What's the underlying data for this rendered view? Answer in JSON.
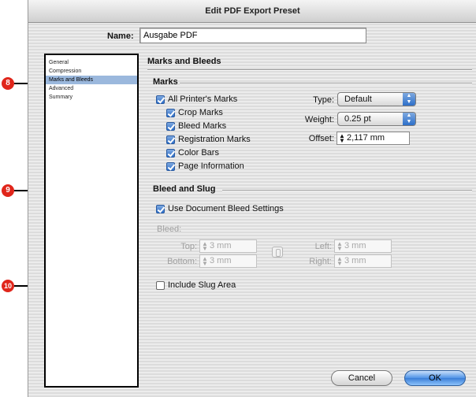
{
  "window": {
    "title": "Edit PDF Export Preset"
  },
  "name": {
    "label": "Name:",
    "value": "Ausgabe PDF"
  },
  "sidebar": {
    "items": [
      {
        "label": "General"
      },
      {
        "label": "Compression"
      },
      {
        "label": "Marks and Bleeds",
        "selected": true
      },
      {
        "label": "Advanced"
      },
      {
        "label": "Summary"
      }
    ]
  },
  "panel": {
    "title": "Marks and Bleeds"
  },
  "marks": {
    "title": "Marks",
    "all_printers_marks": {
      "label": "All Printer's Marks",
      "checked": true
    },
    "crop_marks": {
      "label": "Crop Marks",
      "checked": true
    },
    "bleed_marks": {
      "label": "Bleed Marks",
      "checked": true
    },
    "registration_marks": {
      "label": "Registration Marks",
      "checked": true
    },
    "color_bars": {
      "label": "Color Bars",
      "checked": true
    },
    "page_information": {
      "label": "Page Information",
      "checked": true
    },
    "type": {
      "label": "Type:",
      "value": "Default"
    },
    "weight": {
      "label": "Weight:",
      "value": "0.25 pt"
    },
    "offset": {
      "label": "Offset:",
      "value": "2,117 mm"
    }
  },
  "bleed_slug": {
    "title": "Bleed and Slug",
    "use_document_bleed": {
      "label": "Use Document Bleed Settings",
      "checked": true
    },
    "bleed_label": "Bleed:",
    "top": {
      "label": "Top:",
      "value": "3 mm"
    },
    "bottom": {
      "label": "Bottom:",
      "value": "3 mm"
    },
    "left": {
      "label": "Left:",
      "value": "3 mm"
    },
    "right": {
      "label": "Right:",
      "value": "3 mm"
    },
    "include_slug": {
      "label": "Include Slug Area",
      "checked": false
    }
  },
  "buttons": {
    "cancel": "Cancel",
    "ok": "OK"
  },
  "callouts": [
    "8",
    "9",
    "10"
  ],
  "colors": {
    "callout": "#e0261b",
    "selection": "#9bb8dd",
    "accent": "#2d6fc9"
  }
}
